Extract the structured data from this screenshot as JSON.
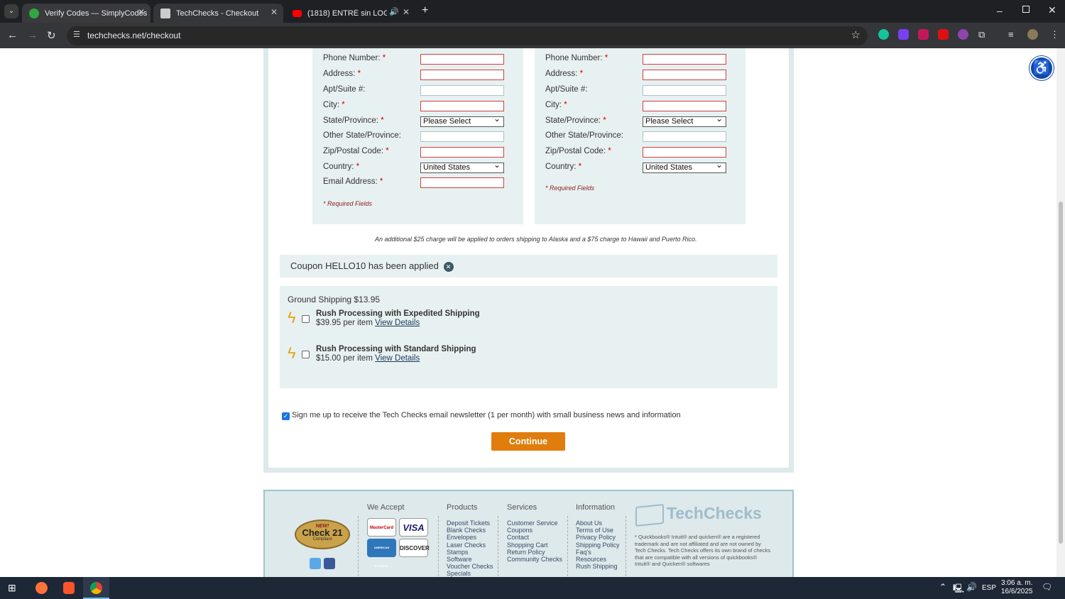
{
  "browser": {
    "tabs": [
      {
        "title": "Verify Codes — SimplyCodes",
        "active": false
      },
      {
        "title": "TechChecks - Checkout",
        "active": true
      },
      {
        "title": "(1818) ENTRÉ sin LOGIN en",
        "active": false
      }
    ],
    "url": "techchecks.net/checkout"
  },
  "billing": {
    "fields": [
      {
        "label": "Phone Number:",
        "required": true,
        "value": ""
      },
      {
        "label": "Address:",
        "required": true,
        "value": ""
      },
      {
        "label": "Apt/Suite #:",
        "required": false,
        "value": ""
      },
      {
        "label": "City:",
        "required": true,
        "value": ""
      },
      {
        "label": "State/Province:",
        "required": true,
        "value": "Please Select"
      },
      {
        "label": "Other State/Province:",
        "required": false,
        "value": ""
      },
      {
        "label": "Zip/Postal Code:",
        "required": true,
        "value": ""
      },
      {
        "label": "Country:",
        "required": true,
        "value": "United States"
      },
      {
        "label": "Email Address:",
        "required": true,
        "value": ""
      }
    ],
    "required_note": "* Required Fields"
  },
  "shipping": {
    "fields": [
      {
        "label": "Phone Number:",
        "required": true,
        "value": ""
      },
      {
        "label": "Address:",
        "required": true,
        "value": ""
      },
      {
        "label": "Apt/Suite #:",
        "required": false,
        "value": ""
      },
      {
        "label": "City:",
        "required": true,
        "value": ""
      },
      {
        "label": "State/Province:",
        "required": true,
        "value": "Please Select"
      },
      {
        "label": "Other State/Province:",
        "required": false,
        "value": ""
      },
      {
        "label": "Zip/Postal Code:",
        "required": true,
        "value": ""
      },
      {
        "label": "Country:",
        "required": true,
        "value": "United States"
      }
    ],
    "required_note": "* Required Fields"
  },
  "req_star": "*",
  "shipping_note": "An additional $25 charge will be applied to orders shipping to Alaska and a $75 charge to Hawaii and Puerto Rico.",
  "coupon": {
    "text": "Coupon HELLO10 has been applied",
    "remove_glyph": "✕"
  },
  "shipping_options": {
    "ground": "Ground Shipping $13.95",
    "options": [
      {
        "title": "Rush Processing with Expedited Shipping",
        "price": "$39.95 per item",
        "link": "View Details",
        "checked": false
      },
      {
        "title": "Rush Processing with Standard Shipping",
        "price": "$15.00 per item",
        "link": "View Details",
        "checked": false
      }
    ]
  },
  "newsletter": {
    "text": "Sign me up to receive the Tech Checks email newsletter (1 per month) with small business news and information",
    "checked": true
  },
  "continue_label": "Continue",
  "footer": {
    "badge": {
      "new": "NEW!",
      "name": "Check 21",
      "sub": "Compliant"
    },
    "we_accept": {
      "title": "We Accept",
      "cards": [
        "MasterCard",
        "VISA",
        "AMERICAN EXPRESS",
        "DISCOVER"
      ]
    },
    "products": {
      "title": "Products",
      "links": [
        "Deposit Tickets",
        "Blank Checks",
        "Envelopes",
        "Laser Checks",
        "Stamps",
        "Software",
        "Voucher Checks",
        "Specials"
      ]
    },
    "services": {
      "title": "Services",
      "links": [
        "Customer Service",
        "Coupons",
        "Contact",
        "Shopping Cart",
        "Return Policy",
        "Community Checks"
      ]
    },
    "information": {
      "title": "Information",
      "links": [
        "About Us",
        "Terms of Use",
        "Privacy Policy",
        "Shipping Policy",
        "Faq's",
        "Resources",
        "Rush Shipping"
      ]
    },
    "brand": "TechChecks",
    "legal": "* Quickbooks® Intuit® and quicken® are a registered trademark and are not affiliated and are not owned by Tech Checks. Tech Checks offers its own brand of checks that are compatible with all versions of quickbooks® Intuit® and Quicken® softwares"
  },
  "taskbar": {
    "lang": "ESP",
    "time": "3:06 a. m.",
    "date": "16/6/2025"
  },
  "colors": {
    "accent": "#e07d0c",
    "panel": "#e8f1f1",
    "required": "#cc0000"
  }
}
